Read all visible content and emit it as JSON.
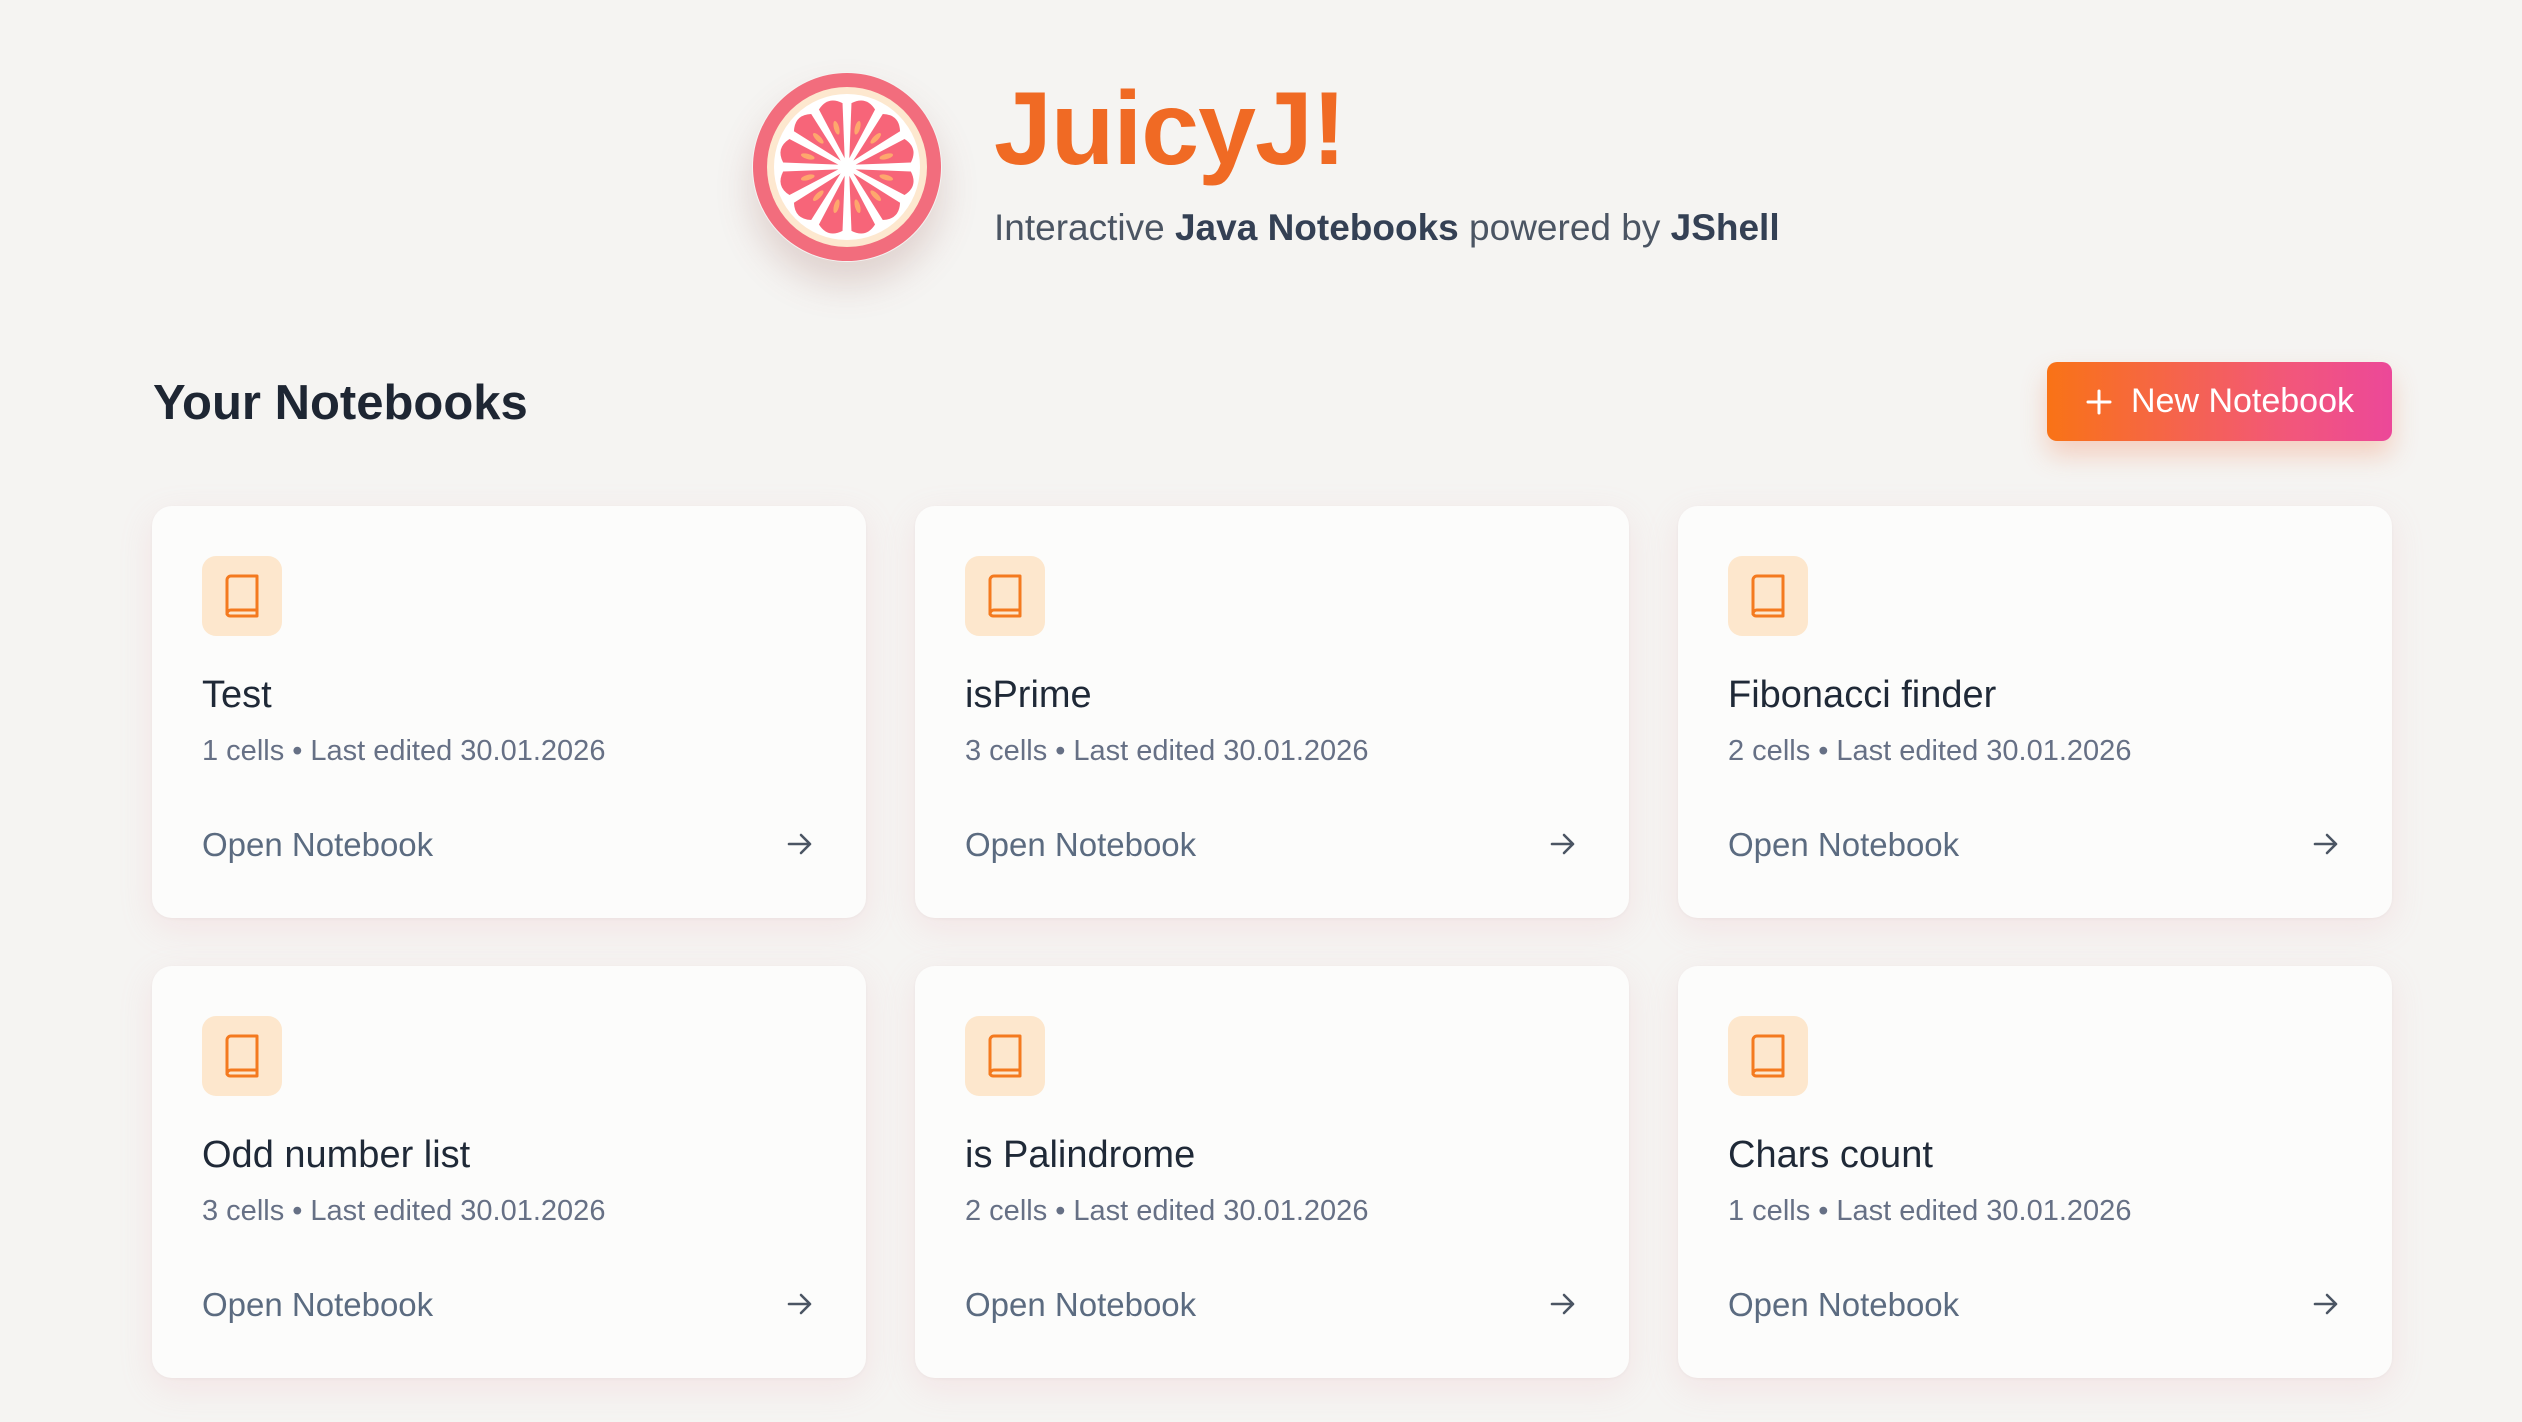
{
  "app": {
    "title": "JuicyJ!",
    "tagline_parts": [
      "Interactive ",
      "Java Notebooks",
      " powered by ",
      "JShell"
    ],
    "logo_icon": "grapefruit-slice-icon"
  },
  "section": {
    "title": "Your Notebooks"
  },
  "actions": {
    "new_notebook_label": "New Notebook",
    "new_notebook_icon": "plus-icon"
  },
  "notebooks": [
    {
      "title": "Test",
      "cells": "1 cells",
      "last_edited": "Last edited 30.01.2026",
      "open_label": "Open Notebook"
    },
    {
      "title": "isPrime",
      "cells": "3 cells",
      "last_edited": "Last edited 30.01.2026",
      "open_label": "Open Notebook"
    },
    {
      "title": "Fibonacci finder",
      "cells": "2 cells",
      "last_edited": "Last edited 30.01.2026",
      "open_label": "Open Notebook"
    },
    {
      "title": "Odd number list",
      "cells": "3 cells",
      "last_edited": "Last edited 30.01.2026",
      "open_label": "Open Notebook"
    },
    {
      "title": "is Palindrome",
      "cells": "2 cells",
      "last_edited": "Last edited 30.01.2026",
      "open_label": "Open Notebook"
    },
    {
      "title": "Chars count",
      "cells": "1 cells",
      "last_edited": "Last edited 30.01.2026",
      "open_label": "Open Notebook"
    }
  ],
  "colors": {
    "background": "#f5f4f2",
    "brand_orange": "#f06a24",
    "brand_pink": "#ec4899",
    "icon_tile": "#fde7cd",
    "icon_stroke": "#f47a1f"
  }
}
